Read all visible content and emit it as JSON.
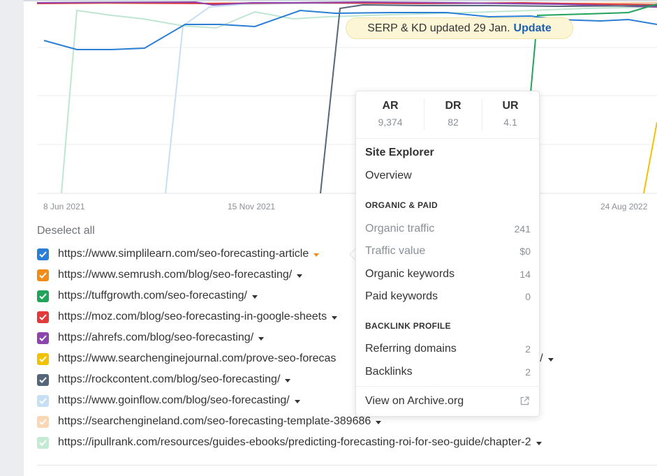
{
  "chart": {
    "x_labels": [
      "8 Jun 2021",
      "15 Nov 2021",
      "24 Aug 2022"
    ]
  },
  "banner": {
    "text": "SERP & KD updated 29 Jan.",
    "link": "Update"
  },
  "deselect_label": "Deselect all",
  "urls": [
    {
      "url": "https://www.simplilearn.com/seo-forecasting-article",
      "color": "#2a7fd4",
      "checked": true,
      "caret_color": "#f08c1a"
    },
    {
      "url": "https://www.semrush.com/blog/seo-forecasting/",
      "color": "#f08c1a",
      "checked": true
    },
    {
      "url": "https://tuffgrowth.com/seo-forecasting/",
      "color": "#22a35a",
      "checked": true
    },
    {
      "url": "https://moz.com/blog/seo-forecasting-in-google-sheets",
      "color": "#e03a3a",
      "checked": true
    },
    {
      "url": "https://ahrefs.com/blog/seo-forecasting/",
      "color": "#8e44ad",
      "checked": true
    },
    {
      "url": "https://www.searchenginejournal.com/prove-seo-forecas",
      "suffix": "67/",
      "color": "#f2c200",
      "checked": true
    },
    {
      "url": "https://rockcontent.com/blog/seo-forecasting/",
      "color": "#55667a",
      "checked": true
    },
    {
      "url": "https://www.goinflow.com/blog/seo-forecasting/",
      "color": "#c7dff5",
      "checked": true
    },
    {
      "url": "https://searchengineland.com/seo-forecasting-template-389686",
      "color": "#f9d7b3",
      "checked": true
    },
    {
      "url": "https://ipullrank.com/resources/guides-ebooks/predicting-forecasting-roi-for-seo-guide/chapter-2",
      "color": "#c4ead4",
      "checked": true
    }
  ],
  "popup": {
    "metrics": [
      {
        "label": "AR",
        "value": "9,374"
      },
      {
        "label": "DR",
        "value": "82"
      },
      {
        "label": "UR",
        "value": "4.1"
      }
    ],
    "title": "Site Explorer",
    "overview": "Overview",
    "section1": "ORGANIC & PAID",
    "organic": [
      {
        "label": "Organic traffic",
        "value": "241",
        "muted": true
      },
      {
        "label": "Traffic value",
        "value": "$0",
        "muted": true
      },
      {
        "label": "Organic keywords",
        "value": "14",
        "muted": false
      },
      {
        "label": "Paid keywords",
        "value": "0",
        "muted": false
      }
    ],
    "section2": "BACKLINK PROFILE",
    "backlinks": [
      {
        "label": "Referring domains",
        "value": "2"
      },
      {
        "label": "Backlinks",
        "value": "2"
      }
    ],
    "archive": "View on Archive.org"
  }
}
